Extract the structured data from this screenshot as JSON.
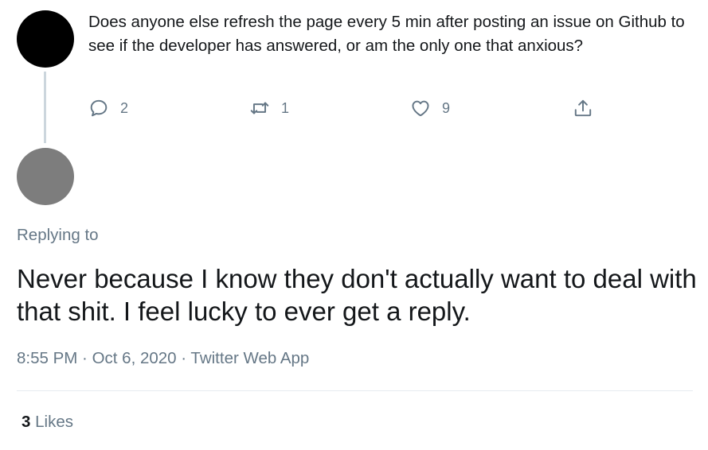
{
  "parent_tweet": {
    "text": "Does anyone else refresh the page every 5 min after posting an issue on Github to see if the developer has answered, or am the only one that anxious?",
    "actions": {
      "reply_count": "2",
      "retweet_count": "1",
      "like_count": "9"
    },
    "icons": [
      "reply-icon",
      "retweet-icon",
      "like-icon",
      "share-icon"
    ]
  },
  "reply_tweet": {
    "replying_to": "Replying to",
    "text": "Never because I know they don't actually want to deal with that shit. I feel lucky to ever get a reply.",
    "meta": {
      "time": "8:55 PM",
      "separator": " · ",
      "date": "Oct 6, 2020",
      "source": "Twitter Web App"
    },
    "likes": {
      "count": "3",
      "label": "Likes"
    }
  },
  "colors": {
    "text": "#14171a",
    "secondary": "#657786",
    "thread_line": "#ccd6dd",
    "divider": "#e6ecf0",
    "parent_avatar": "#000000",
    "reply_avatar": "#7d7d7d"
  }
}
